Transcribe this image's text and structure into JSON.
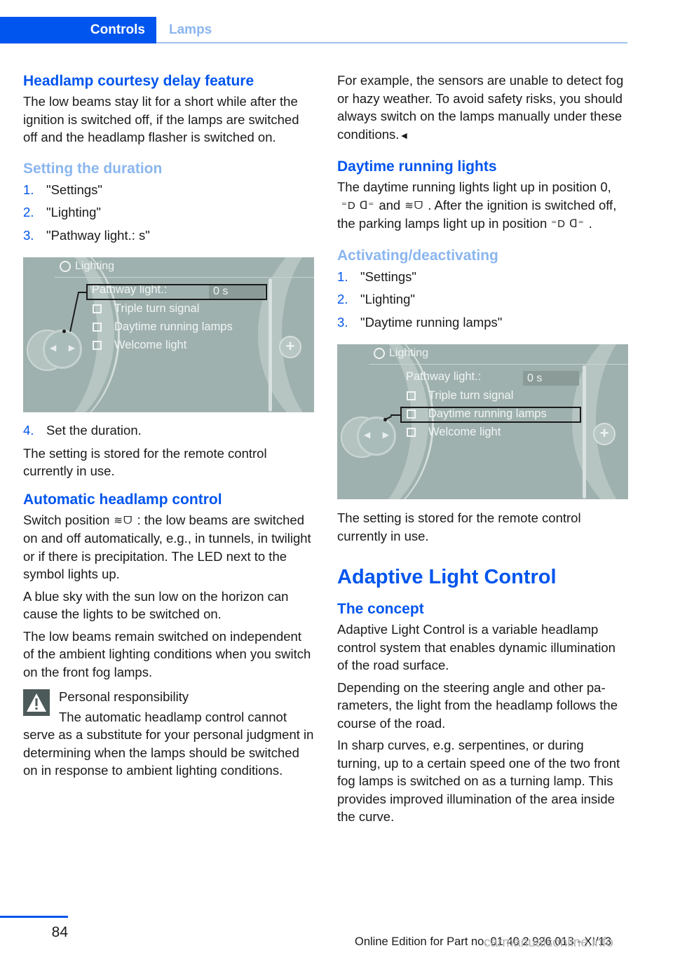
{
  "header": {
    "tab_active": "Controls",
    "tab_inactive": "Lamps"
  },
  "colors": {
    "accent": "#0055ee",
    "accent_light": "#8ab6ef",
    "screen_bg": "#9fb1ae"
  },
  "left": {
    "courtesy": {
      "heading": "Headlamp courtesy delay feature",
      "body": "The low beams stay lit for a short while after the ignition is switched off, if the lamps are switched off and the headlamp flasher is switched on."
    },
    "duration": {
      "heading": "Setting the duration",
      "steps": [
        {
          "num": "1.",
          "text": "\"Settings\""
        },
        {
          "num": "2.",
          "text": "\"Lighting\""
        },
        {
          "num": "3.",
          "text": "\"Pathway light.: s\""
        }
      ],
      "step4": {
        "num": "4.",
        "text": "Set the duration."
      },
      "note": "The setting is stored for the remote control currently in use."
    },
    "auto": {
      "heading": "Automatic headlamp control",
      "p1_before": "Switch position",
      "p1_after": ": the low beams are switched on and off automatically, e.g., in tun­nels, in twilight or if there is precipitation. The LED next to the symbol lights up.",
      "p2": "A blue sky with the sun low on the horizon can cause the lights to be switched on.",
      "p3": "The low beams remain switched on independ­ent of the ambient lighting conditions when you switch on the front fog lamps."
    },
    "warning": {
      "title": "Personal responsibility",
      "body": "The automatic headlamp control cannot serve as a substitute for your personal judg­ment in determining when the lamps should be switched on in response to ambient lighting conditions."
    }
  },
  "screen": {
    "title": "Lighting",
    "pathway_label": "Pathway light.:",
    "pathway_value": "0 s",
    "options": [
      "Triple turn signal",
      "Daytime running lamps",
      "Welcome light"
    ]
  },
  "right": {
    "intro": "For example, the sensors are unable to detect fog or hazy weather. To avoid safety risks, you should always switch on the lamps manually under these conditions.",
    "intro_end": "◄",
    "drl": {
      "heading": "Daytime running lights",
      "p_a": "The daytime running lights light up in posi­tion 0,",
      "p_and": "and",
      "p_b": ". After the ignition is switched off, the parking lamps light up in po­sition",
      "p_end": "."
    },
    "activating": {
      "heading": "Activating/deactivating",
      "steps": [
        {
          "num": "1.",
          "text": "\"Settings\""
        },
        {
          "num": "2.",
          "text": "\"Lighting\""
        },
        {
          "num": "3.",
          "text": "\"Daytime running lamps\""
        }
      ],
      "note": "The setting is stored for the remote control currently in use."
    },
    "alc": {
      "heading": "Adaptive Light Control",
      "subheading": "The concept",
      "p1": "Adaptive Light Control is a variable headlamp control system that enables dynamic illumina­tion of the road surface.",
      "p2": "Depending on the steering angle and other pa­rameters, the light from the headlamp follows the course of the road.",
      "p3": "In sharp curves, e.g. serpentines, or during turning, up to a certain speed one of the two front fog lamps is switched on as a turning lamp. This provides improved illumination of the area inside the curve."
    }
  },
  "icons": {
    "parking_lights": "parking-lights-icon",
    "auto_headlamp": "auto-headlamp-icon",
    "warning": "warning-triangle-icon"
  },
  "footer": {
    "page_number": "84",
    "edition": "Online Edition for Part no. 01 40 2 926 013 - XI/13",
    "watermark": "carmanualsonline.info"
  }
}
